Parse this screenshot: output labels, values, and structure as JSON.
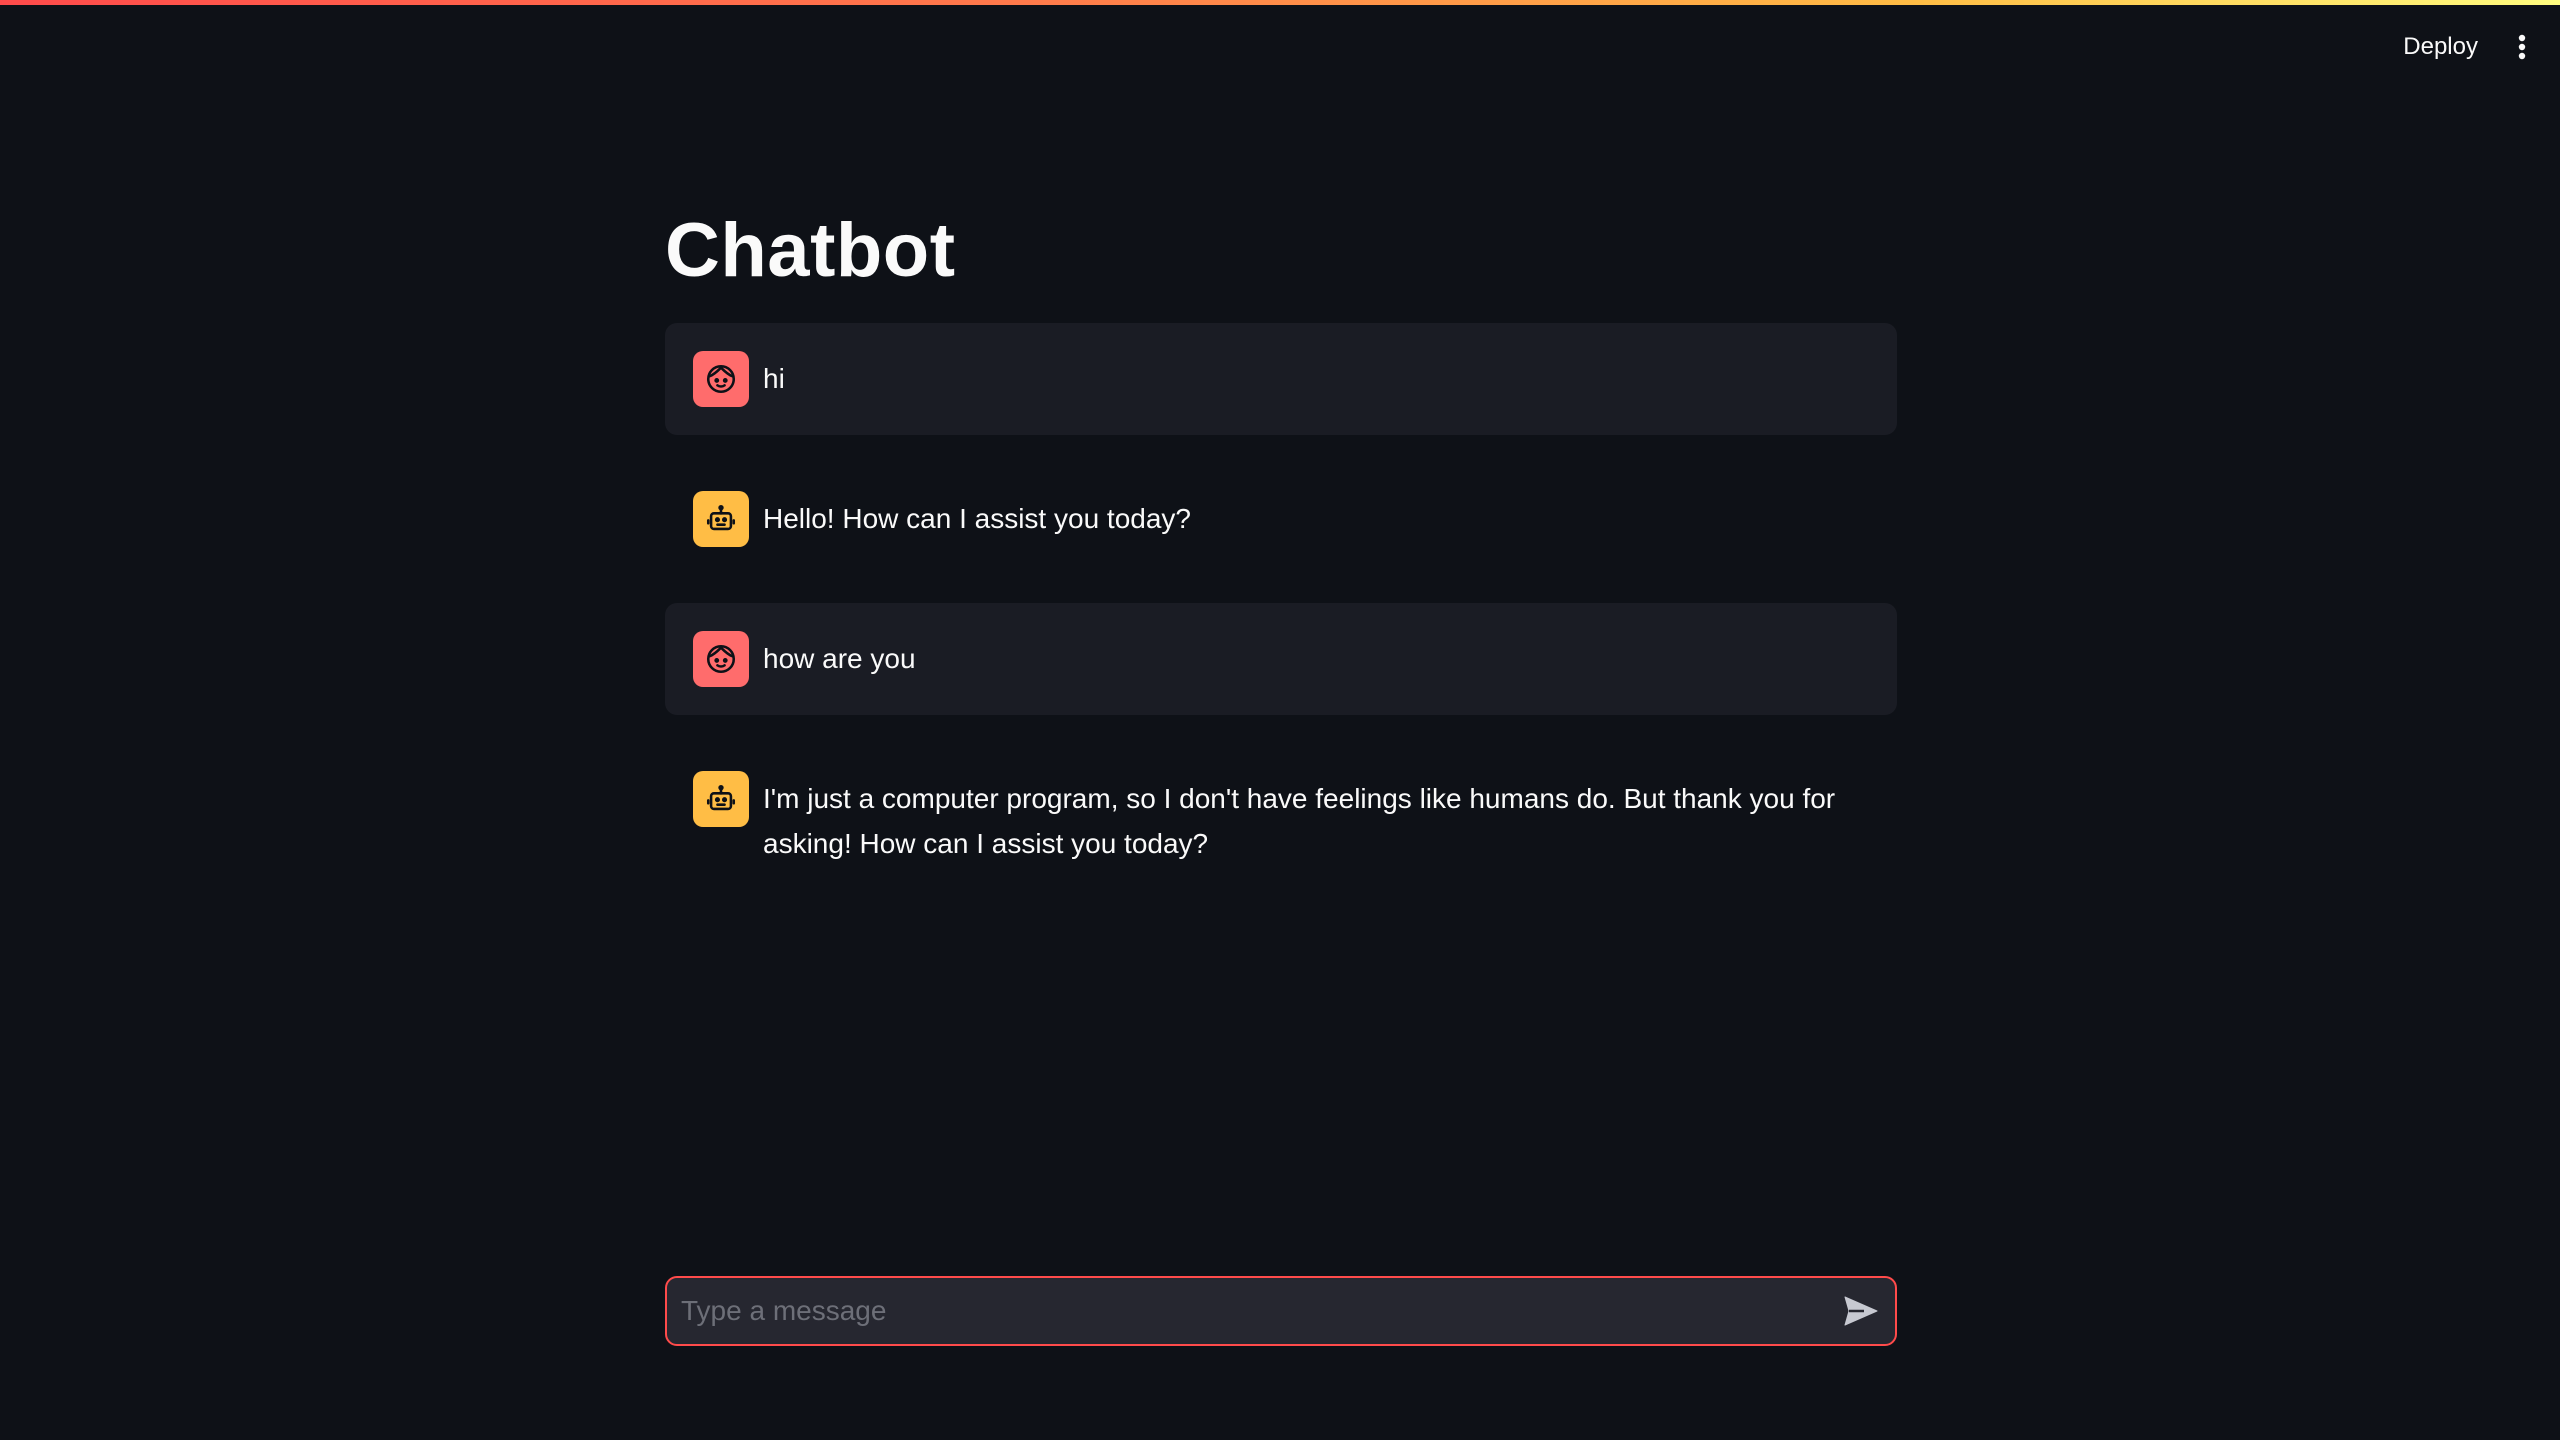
{
  "header": {
    "deploy_label": "Deploy",
    "menu_icon": "vertical-dots-icon"
  },
  "main": {
    "title": "Chatbot"
  },
  "messages": [
    {
      "role": "user",
      "avatar_icon": "user-face-icon",
      "text": "hi"
    },
    {
      "role": "assistant",
      "avatar_icon": "robot-icon",
      "text": "Hello! How can I assist you today?"
    },
    {
      "role": "user",
      "avatar_icon": "user-face-icon",
      "text": "how are you"
    },
    {
      "role": "assistant",
      "avatar_icon": "robot-icon",
      "text": "I'm just a computer program, so I don't have feelings like humans do. But thank you for asking! How can I assist you today?"
    }
  ],
  "chat_input": {
    "placeholder": "Type a message",
    "value": "",
    "send_icon": "send-icon"
  },
  "colors": {
    "background": "#0e1117",
    "user_bubble": "#1a1c24",
    "user_avatar": "#ff6c6c",
    "assistant_avatar": "#ffbd45",
    "accent": "#ff4b4b"
  }
}
